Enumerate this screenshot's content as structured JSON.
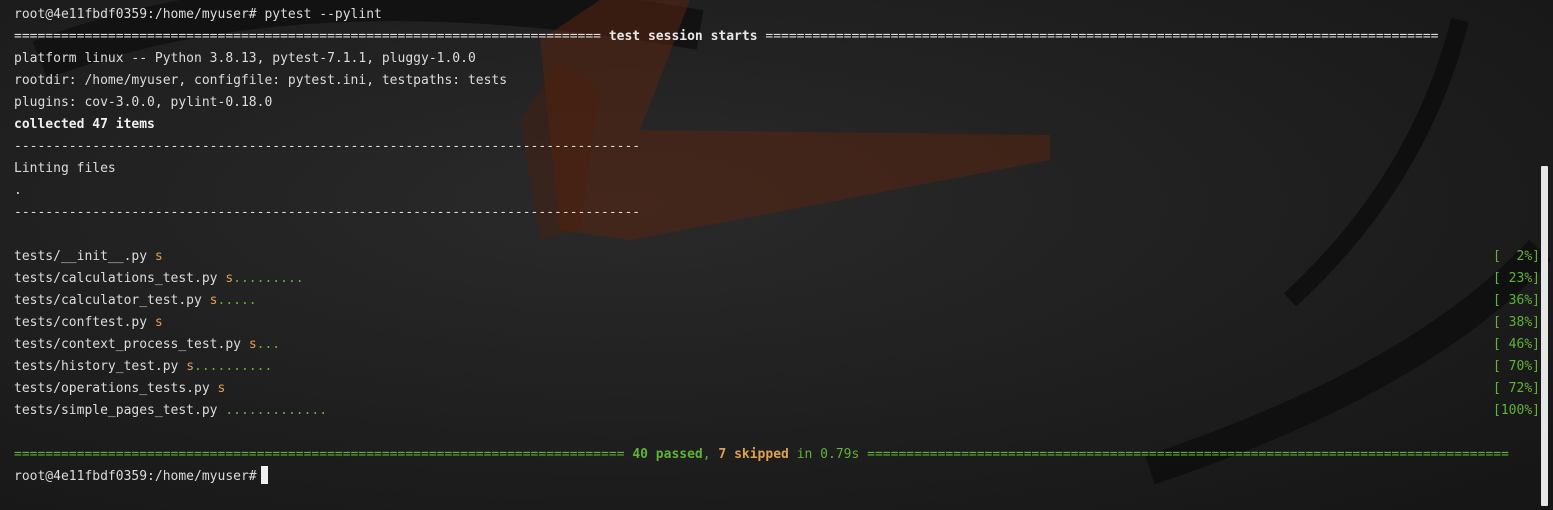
{
  "terminal": {
    "prompt_command": "root@4e11fbdf0359:/home/myuser# pytest --pylint",
    "session_header": {
      "left": "=========================================================================== ",
      "text": "test session starts",
      "right": " ======================================================================================"
    },
    "platform_line": "platform linux -- Python 3.8.13, pytest-7.1.1, pluggy-1.0.0",
    "rootdir_line": "rootdir: /home/myuser, configfile: pytest.ini, testpaths: tests",
    "plugins_line": "plugins: cov-3.0.0, pylint-0.18.0",
    "collected_line": "collected 47 items",
    "dash_line": "--------------------------------------------------------------------------------",
    "linting_line": "Linting files",
    "lint_dot": ".",
    "results": [
      {
        "file": "tests/__init__.py",
        "skipped": "s",
        "passed": "",
        "percent": "[  2%]"
      },
      {
        "file": "tests/calculations_test.py",
        "skipped": "s",
        "passed": ".........",
        "percent": "[ 23%]"
      },
      {
        "file": "tests/calculator_test.py",
        "skipped": "s",
        "passed": ".....",
        "percent": "[ 36%]"
      },
      {
        "file": "tests/conftest.py",
        "skipped": "s",
        "passed": "",
        "percent": "[ 38%]"
      },
      {
        "file": "tests/context_process_test.py",
        "skipped": "s",
        "passed": "...",
        "percent": "[ 46%]"
      },
      {
        "file": "tests/history_test.py",
        "skipped": "s",
        "passed": "..........",
        "percent": "[ 70%]"
      },
      {
        "file": "tests/operations_tests.py",
        "skipped": "s",
        "passed": "",
        "percent": "[ 72%]"
      },
      {
        "file": "tests/simple_pages_test.py",
        "skipped": "",
        "passed": ".............",
        "percent": "[100%]"
      }
    ],
    "summary": {
      "left": "============================================================================== ",
      "passed": "40 passed",
      "comma": ", ",
      "skipped": "7 skipped",
      "time": " in 0.79s ",
      "right": "=================================================================================="
    },
    "prompt_final": "root@4e11fbdf0359:/home/myuser#"
  },
  "colors": {
    "background": "#1c1c1c",
    "pass_green": "#5fb336",
    "skip_orange": "#e0a050",
    "text": "#dcdcdc"
  }
}
